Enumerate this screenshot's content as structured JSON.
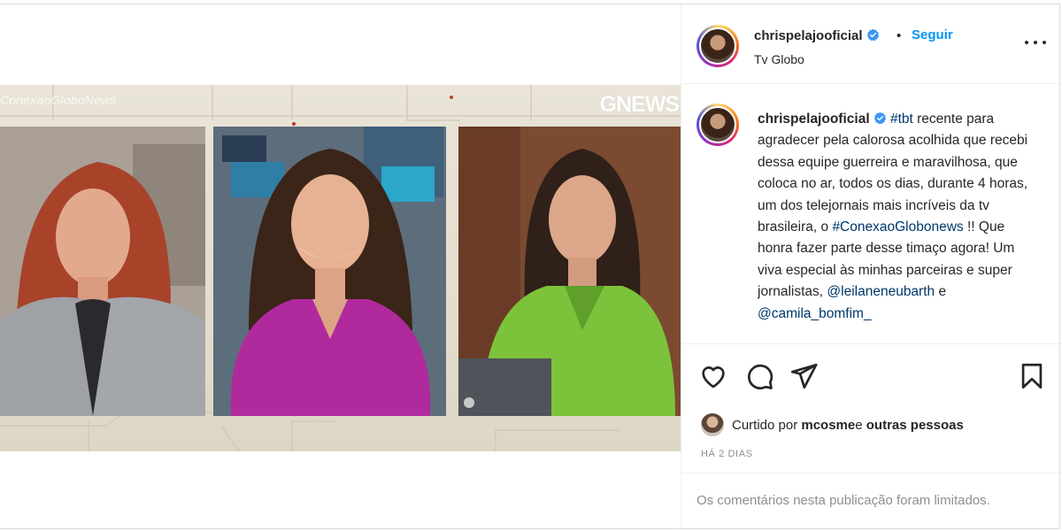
{
  "media": {
    "studio_caption": "ConexaoGloboNews",
    "logo_text": "GNEWS"
  },
  "post": {
    "username": "chrispelajooficial",
    "follow_label": "Seguir",
    "separator": "•",
    "location": "Tv Globo"
  },
  "caption": {
    "username": "chrispelajooficial",
    "hashtag_tbt": "#tbt",
    "text_part1": " recente para agradecer pela calorosa acolhida que recebi dessa equipe guerreira e maravilhosa, que coloca no ar, todos os dias, durante 4 horas, um dos telejornais mais incríveis da tv brasileira, o ",
    "hashtag_conexao": "#ConexaoGlobonews",
    "text_part2": " !! Que honra fazer parte desse timaço agora! Um viva especial às minhas parceiras e super jornalistas, ",
    "mention_1": "@leilaneneubarth",
    "conjunction": " e ",
    "mention_2": "@camila_bomfim_"
  },
  "actions": {
    "like_icon": "heart-icon",
    "comment_icon": "comment-icon",
    "share_icon": "send-icon",
    "save_icon": "bookmark-icon"
  },
  "likes": {
    "prefix": "Curtido por ",
    "user": "mcosme",
    "middle": " e ",
    "others": "outras pessoas"
  },
  "time_ago": "HÁ 2 DIAS",
  "comments_notice": "Os comentários nesta publicação foram limitados.",
  "colors": {
    "link_blue": "#0095f6",
    "hashtag_blue": "#00376b",
    "verified_blue": "#3897f0",
    "muted_gray": "#8e8e8e"
  }
}
